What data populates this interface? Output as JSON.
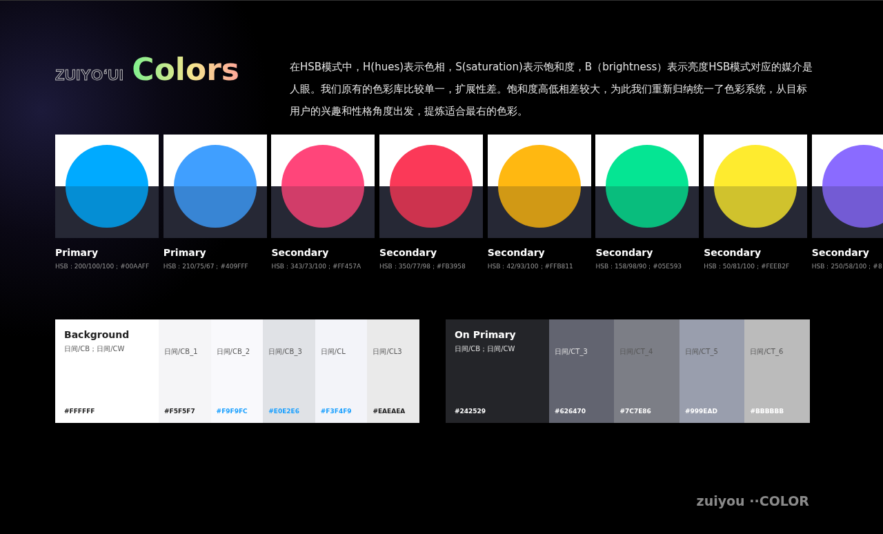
{
  "brand": {
    "logo": "ZUIYO‘UI",
    "title": "Colors"
  },
  "description": "在HSB模式中，H(hues)表示色相，S(saturation)表示饱和度，B（brightness）表示亮度HSB模式对应的媒介是人眼。我们原有的色彩库比较单一，扩展性差。饱和度高低相差较大，为此我们重新归纳统一了色彩系统，从目标用户的兴趣和性格角度出发，提炼适合最右的色彩。",
  "swatches": [
    {
      "label": "Primary",
      "spec": "HSB：200/100/100；#00AAFF",
      "color": "#00aaff"
    },
    {
      "label": "Primary",
      "spec": "HSB：210/75/67；#409FFF",
      "color": "#409fff"
    },
    {
      "label": "Secondary",
      "spec": "HSB：343/73/100；#FF457A",
      "color": "#ff457a"
    },
    {
      "label": "Secondary",
      "spec": "HSB：350/77/98；#FB3958",
      "color": "#fb3958"
    },
    {
      "label": "Secondary",
      "spec": "HSB：42/93/100；#FFB811",
      "color": "#ffb811"
    },
    {
      "label": "Secondary",
      "spec": "HSB：158/98/90；#05E593",
      "color": "#05e593"
    },
    {
      "label": "Secondary",
      "spec": "HSB：50/81/100；#FEEB2F",
      "color": "#feeb2f"
    },
    {
      "label": "Secondary",
      "spec": "HSB：250/58/100；#8",
      "color": "#8a6bff"
    }
  ],
  "palettes": [
    {
      "title": "Background",
      "tones": [
        {
          "name": "日间/CB；日间/CW",
          "hex": "#FFFFFF",
          "color": "#ffffff",
          "highlight": false
        },
        {
          "name": "日间/CB_1",
          "hex": "#F5F5F7",
          "color": "#f5f5f7",
          "highlight": false
        },
        {
          "name": "日间/CB_2",
          "hex": "#F9F9FC",
          "color": "#f9f9fc",
          "highlight": true
        },
        {
          "name": "日间/CB_3",
          "hex": "#E0E2E6",
          "color": "#e0e2e6",
          "highlight": true
        },
        {
          "name": "日间/CL",
          "hex": "#F3F4F9",
          "color": "#f3f4f9",
          "highlight": true
        },
        {
          "name": "日间/CL3",
          "hex": "#EAEAEA",
          "color": "#eaeaea",
          "highlight": false
        }
      ]
    },
    {
      "title": "On Primary",
      "tones": [
        {
          "name": "日间/CB；日间/CW",
          "hex": "#242529",
          "color": "#242529",
          "highlight": false
        },
        {
          "name": "日间/CT_3",
          "hex": "#626470",
          "color": "#626470",
          "highlight": false
        },
        {
          "name": "日间/CT_4",
          "hex": "#7C7E86",
          "color": "#7c7e86",
          "highlight": false
        },
        {
          "name": "日间/CT_5",
          "hex": "#999EAD",
          "color": "#999ead",
          "highlight": false
        },
        {
          "name": "日间/CT_6",
          "hex": "#BBBBBB",
          "color": "#bbbbbb",
          "highlight": false
        }
      ]
    }
  ],
  "footer": "zuiyou ··COLOR"
}
